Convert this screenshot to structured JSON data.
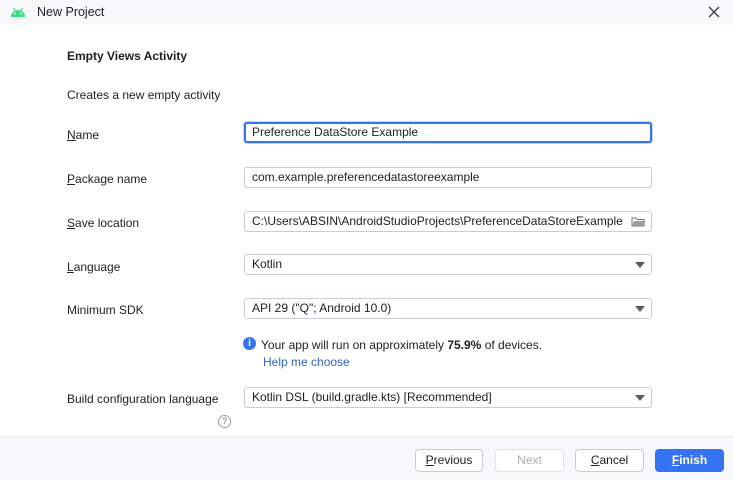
{
  "window": {
    "title": "New Project",
    "app_icon": "android-icon",
    "close_icon": "close-icon"
  },
  "form": {
    "heading": "Empty Views Activity",
    "description": "Creates a new empty activity",
    "name": {
      "label_mnemonic": "N",
      "label_rest": "ame",
      "value": "Preference DataStore Example"
    },
    "package": {
      "label_mnemonic": "P",
      "label_rest": "ackage name",
      "value": "com.example.preferencedatastoreexample"
    },
    "save_location": {
      "label_mnemonic": "S",
      "label_rest": "ave location",
      "value": "C:\\Users\\ABSIN\\AndroidStudioProjects\\PreferenceDataStoreExample",
      "icon": "folder-icon"
    },
    "language": {
      "label_mnemonic": "L",
      "label_rest": "anguage",
      "value": "Kotlin"
    },
    "min_sdk": {
      "label": "Minimum SDK",
      "value": "API 29 (\"Q\"; Android 10.0)"
    },
    "info": {
      "icon": "info-icon",
      "text_before": "Your app will run on approximately ",
      "percent": "75.9%",
      "text_after": " of devices.",
      "link": "Help me choose"
    },
    "build_config": {
      "label": "Build configuration language",
      "help_icon": "help-icon",
      "value": "Kotlin DSL (build.gradle.kts) [Recommended]"
    }
  },
  "footer": {
    "previous": {
      "mnemonic": "P",
      "rest": "revious"
    },
    "next": "Next",
    "cancel": {
      "mnemonic": "C",
      "rest": "ancel"
    },
    "finish": {
      "mnemonic": "F",
      "rest": "inish"
    }
  },
  "colors": {
    "accent": "#3574f0",
    "link": "#2f65ca",
    "window_bg": "#f7f8fa",
    "content_bg": "#ffffff"
  }
}
